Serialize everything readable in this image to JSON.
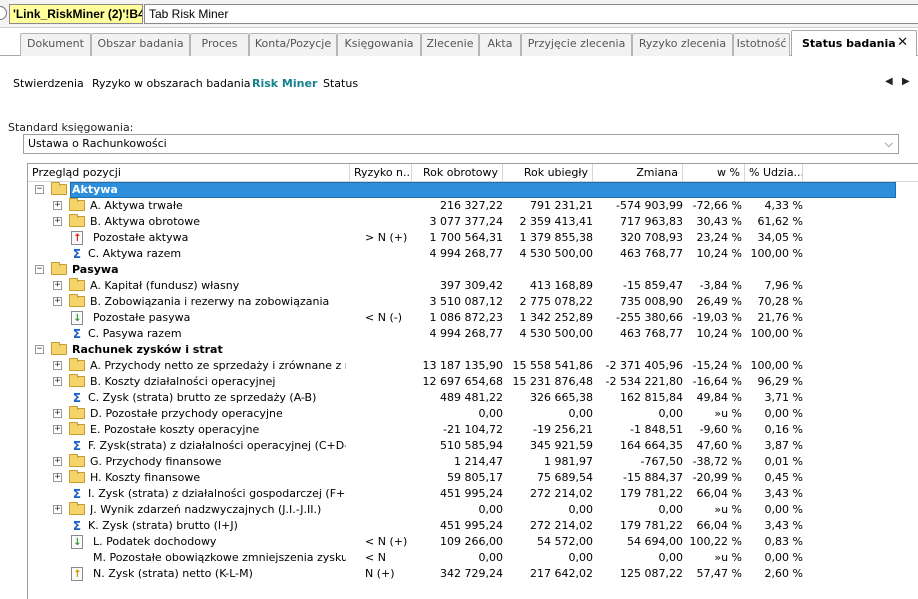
{
  "formula_bar": {
    "ref": "'Link_RiskMiner (2)'!B4",
    "value": "Tab Risk Miner"
  },
  "main_tabs": [
    "Dokument",
    "Obszar badania",
    "Proces",
    "Konta/Pozycje",
    "Księgowania",
    "Zlecenie",
    "Akta",
    "Przyjęcie zlecenia",
    "Ryzyko zlecenia",
    "Istotność",
    "Status badania"
  ],
  "active_tab": "Status badania",
  "close_glyph": "✕",
  "sub_tabs": [
    "Stwierdzenia",
    "Ryzyko w obszarach badania",
    "Risk Miner",
    "Status"
  ],
  "active_sub_tab": "Risk Miner",
  "nav": {
    "prev": "◀",
    "next": "▶"
  },
  "standard": {
    "label": "Standard księgowania:",
    "value": "Ustawa o Rachunkowości",
    "caret": "⌵"
  },
  "columns": [
    "Przegląd pozycji",
    "Ryzyko n...",
    "Rok obrotowy",
    "Rok ubiegły",
    "Zmiana",
    "w %",
    "% Udzia..."
  ],
  "rows": [
    {
      "level": 0,
      "icon": "folder-icon",
      "exp": "−",
      "name": "Aktywa",
      "bold": true,
      "sel": true,
      "risk": "",
      "cur": "",
      "prev": "",
      "chg": "",
      "pct": "",
      "share": ""
    },
    {
      "level": 1,
      "icon": "folder-icon",
      "exp": "+",
      "name": "A. Aktywa trwałe",
      "risk": "",
      "cur": "216 327,22",
      "prev": "791 231,21",
      "chg": "-574 903,99",
      "pct": "-72,66 %",
      "share": "4,33 %"
    },
    {
      "level": 1,
      "icon": "folder-icon",
      "exp": "+",
      "name": "B. Aktywa obrotowe",
      "risk": "",
      "cur": "3 077 377,24",
      "prev": "2 359 413,41",
      "chg": "717 963,83",
      "pct": "30,43 %",
      "share": "61,62 %"
    },
    {
      "level": 1,
      "icon": "doc-red-icon",
      "exp": "",
      "name": "Pozostałe aktywa",
      "risk": "> N (+)",
      "cur": "1 700 564,31",
      "prev": "1 379 855,38",
      "chg": "320 708,93",
      "pct": "23,24 %",
      "share": "34,05 %"
    },
    {
      "level": 1,
      "icon": "sigma-icon",
      "exp": "",
      "name": "C. Aktywa razem",
      "risk": "",
      "cur": "4 994 268,77",
      "prev": "4 530 500,00",
      "chg": "463 768,77",
      "pct": "10,24 %",
      "share": "100,00 %"
    },
    {
      "level": 0,
      "icon": "folder-icon",
      "exp": "−",
      "name": "Pasywa",
      "bold": true,
      "risk": "",
      "cur": "",
      "prev": "",
      "chg": "",
      "pct": "",
      "share": ""
    },
    {
      "level": 1,
      "icon": "folder-icon",
      "exp": "+",
      "name": "A. Kapitał (fundusz) własny",
      "risk": "",
      "cur": "397 309,42",
      "prev": "413 168,89",
      "chg": "-15 859,47",
      "pct": "-3,84 %",
      "share": "7,96 %"
    },
    {
      "level": 1,
      "icon": "folder-icon",
      "exp": "+",
      "name": "B. Zobowiązania i rezerwy na zobowiązania",
      "risk": "",
      "cur": "3 510 087,12",
      "prev": "2 775 078,22",
      "chg": "735 008,90",
      "pct": "26,49 %",
      "share": "70,28 %"
    },
    {
      "level": 1,
      "icon": "doc-green-icon",
      "exp": "",
      "name": "Pozostałe pasywa",
      "risk": "< N (-)",
      "cur": "1 086 872,23",
      "prev": "1 342 252,89",
      "chg": "-255 380,66",
      "pct": "-19,03 %",
      "share": "21,76 %"
    },
    {
      "level": 1,
      "icon": "sigma-icon",
      "exp": "",
      "name": "C. Pasywa razem",
      "risk": "",
      "cur": "4 994 268,77",
      "prev": "4 530 500,00",
      "chg": "463 768,77",
      "pct": "10,24 %",
      "share": "100,00 %"
    },
    {
      "level": 0,
      "icon": "folder-icon",
      "exp": "−",
      "name": "Rachunek zysków i strat",
      "bold": true,
      "risk": "",
      "cur": "",
      "prev": "",
      "chg": "",
      "pct": "",
      "share": ""
    },
    {
      "level": 1,
      "icon": "folder-icon",
      "exp": "+",
      "name": "A. Przychody netto ze sprzedaży i zrównane z nimi, w.",
      "risk": "",
      "cur": "13 187 135,90",
      "prev": "15 558 541,86",
      "chg": "-2 371 405,96",
      "pct": "-15,24 %",
      "share": "100,00 %"
    },
    {
      "level": 1,
      "icon": "folder-icon",
      "exp": "+",
      "name": "B. Koszty działalności operacyjnej",
      "risk": "",
      "cur": "12 697 654,68",
      "prev": "15 231 876,48",
      "chg": "-2 534 221,80",
      "pct": "-16,64 %",
      "share": "96,29 %"
    },
    {
      "level": 1,
      "icon": "sigma-icon",
      "exp": "",
      "name": "C. Zysk (strata) brutto ze sprzedaży (A-B)",
      "risk": "",
      "cur": "489 481,22",
      "prev": "326 665,38",
      "chg": "162 815,84",
      "pct": "49,84 %",
      "share": "3,71 %"
    },
    {
      "level": 1,
      "icon": "folder-icon",
      "exp": "+",
      "name": "D. Pozostałe przychody operacyjne",
      "risk": "",
      "cur": "0,00",
      "prev": "0,00",
      "chg": "0,00",
      "pct": "»u %",
      "share": "0,00 %"
    },
    {
      "level": 1,
      "icon": "folder-icon",
      "exp": "+",
      "name": "E. Pozostałe koszty operacyjne",
      "risk": "",
      "cur": "-21 104,72",
      "prev": "-19 256,21",
      "chg": "-1 848,51",
      "pct": "-9,60 %",
      "share": "0,16 %"
    },
    {
      "level": 1,
      "icon": "sigma-icon",
      "exp": "",
      "name": "F. Zysk(strata) z działalności operacyjnej (C+D-E)",
      "risk": "",
      "cur": "510 585,94",
      "prev": "345 921,59",
      "chg": "164 664,35",
      "pct": "47,60 %",
      "share": "3,87 %"
    },
    {
      "level": 1,
      "icon": "folder-icon",
      "exp": "+",
      "name": "G. Przychody finansowe",
      "risk": "",
      "cur": "1 214,47",
      "prev": "1 981,97",
      "chg": "-767,50",
      "pct": "-38,72 %",
      "share": "0,01 %"
    },
    {
      "level": 1,
      "icon": "folder-icon",
      "exp": "+",
      "name": "H. Koszty finansowe",
      "risk": "",
      "cur": "59 805,17",
      "prev": "75 689,54",
      "chg": "-15 884,37",
      "pct": "-20,99 %",
      "share": "0,45 %"
    },
    {
      "level": 1,
      "icon": "sigma-icon",
      "exp": "",
      "name": "I. Zysk (strata) z działalności gospodarczej (F+G-H)",
      "risk": "",
      "cur": "451 995,24",
      "prev": "272 214,02",
      "chg": "179 781,22",
      "pct": "66,04 %",
      "share": "3,43 %"
    },
    {
      "level": 1,
      "icon": "folder-icon",
      "exp": "+",
      "name": "J. Wynik zdarzeń nadzwyczajnych (J.I.-J.II.)",
      "risk": "",
      "cur": "0,00",
      "prev": "0,00",
      "chg": "0,00",
      "pct": "»u %",
      "share": "0,00 %"
    },
    {
      "level": 1,
      "icon": "sigma-icon",
      "exp": "",
      "name": "K. Zysk (strata) brutto (I+J)",
      "risk": "",
      "cur": "451 995,24",
      "prev": "272 214,02",
      "chg": "179 781,22",
      "pct": "66,04 %",
      "share": "3,43 %"
    },
    {
      "level": 1,
      "icon": "doc-green-icon",
      "exp": "",
      "name": "L. Podatek dochodowy",
      "risk": "< N (+)",
      "cur": "109 266,00",
      "prev": "54 572,00",
      "chg": "54 694,00",
      "pct": "100,22 %",
      "share": "0,83 %"
    },
    {
      "level": 1,
      "icon": "blank",
      "exp": "",
      "name": "M. Pozostałe obowiązkowe zmniejszenia zysku (zwi...",
      "risk": "< N",
      "cur": "0,00",
      "prev": "0,00",
      "chg": "0,00",
      "pct": "»u %",
      "share": "0,00 %"
    },
    {
      "level": 1,
      "icon": "doc-yellow-icon",
      "exp": "",
      "name": "N. Zysk (strata) netto (K-L-M)",
      "risk": "N (+)",
      "cur": "342 729,24",
      "prev": "217 642,02",
      "chg": "125 087,22",
      "pct": "57,47 %",
      "share": "2,60 %"
    }
  ]
}
